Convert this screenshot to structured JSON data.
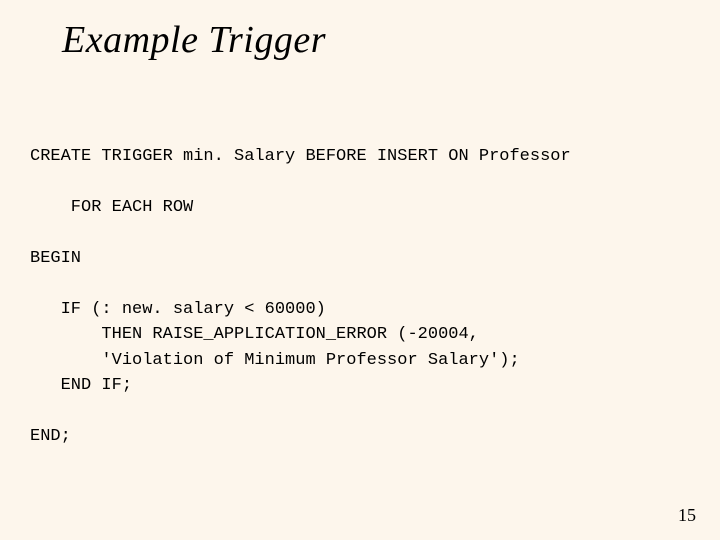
{
  "title": "Example Trigger",
  "code": {
    "l1": "CREATE TRIGGER min. Salary BEFORE INSERT ON Professor",
    "l2": "    FOR EACH ROW",
    "l3": "BEGIN",
    "l4": "   IF (: new. salary < 60000)",
    "l5": "       THEN RAISE_APPLICATION_ERROR (-20004,",
    "l6": "       'Violation of Minimum Professor Salary');",
    "l7": "   END IF;",
    "l8": "END;"
  },
  "page_number": "15"
}
